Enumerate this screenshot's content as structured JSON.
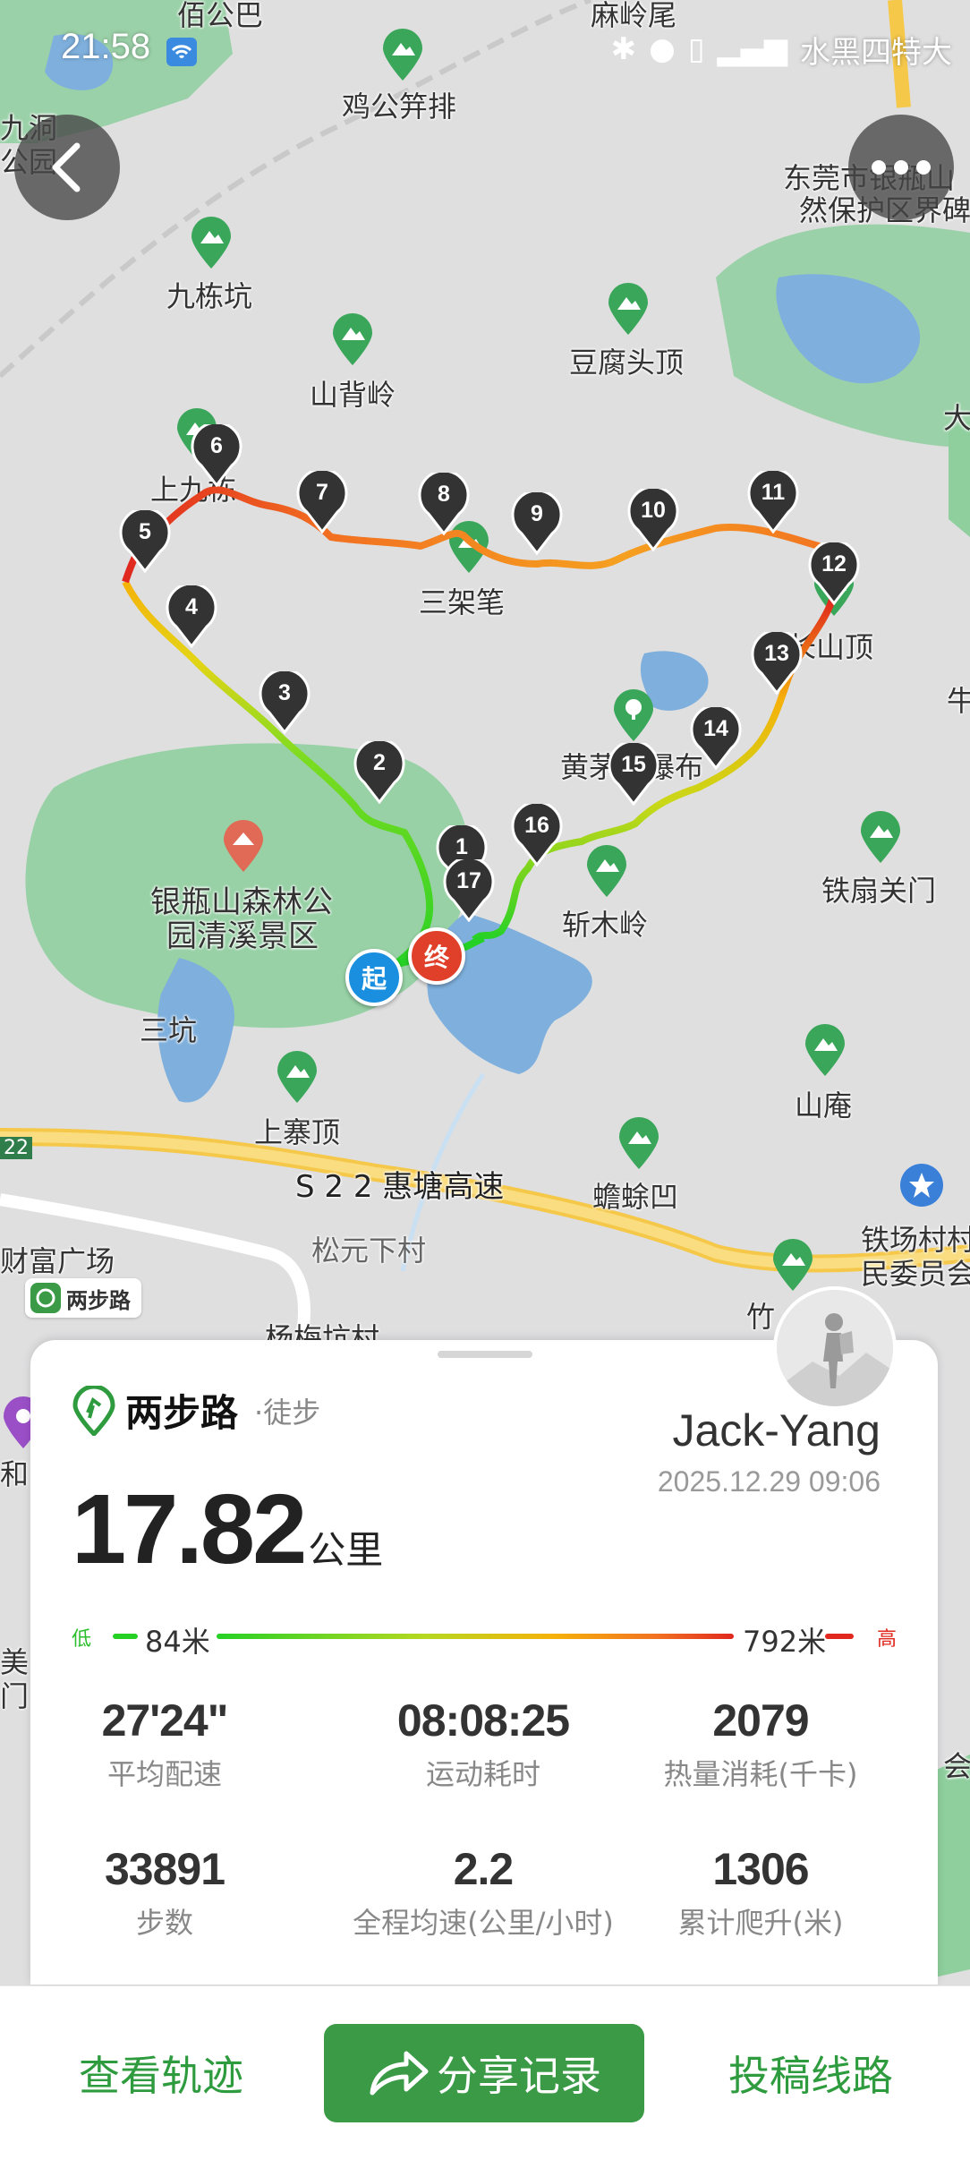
{
  "status_bar": {
    "time": "21:58",
    "carrier_text": "水黑四特大"
  },
  "map": {
    "labels": [
      {
        "text": "佰公巴"
      },
      {
        "text": "麻岭尾"
      },
      {
        "text": "鸡公笄排"
      },
      {
        "text": "九洞"
      },
      {
        "text": "公园"
      },
      {
        "text": "东莞市银瓶山"
      },
      {
        "text": "然保护区界碑"
      },
      {
        "text": "九栋坑"
      },
      {
        "text": "山背岭"
      },
      {
        "text": "豆腐头顶"
      },
      {
        "text": "大"
      },
      {
        "text": "上九栋"
      },
      {
        "text": "三架笔"
      },
      {
        "text": "长山顶"
      },
      {
        "text": "牛"
      },
      {
        "text": "黄茅田瀑布"
      },
      {
        "text": "银瓶山森林公"
      },
      {
        "text": "园清溪景区"
      },
      {
        "text": "斩木岭"
      },
      {
        "text": "铁扇关门"
      },
      {
        "text": "三坑"
      },
      {
        "text": "上寨顶"
      },
      {
        "text": "山庵"
      },
      {
        "text": "S 2 2 惠塘高速"
      },
      {
        "text": "蟾蜍凹"
      },
      {
        "text": "22"
      },
      {
        "text": "财富广场"
      },
      {
        "text": "松元下村"
      },
      {
        "text": "铁场村村"
      },
      {
        "text": "民委员会"
      },
      {
        "text": "杨梅坑村"
      },
      {
        "text": "竹"
      },
      {
        "text": "和"
      },
      {
        "text": "美"
      },
      {
        "text": "门"
      },
      {
        "text": "会"
      }
    ],
    "watermark": "两步路",
    "track_markers": [
      "1",
      "2",
      "3",
      "4",
      "5",
      "6",
      "7",
      "8",
      "9",
      "10",
      "11",
      "12",
      "13",
      "14",
      "15",
      "16",
      "17"
    ],
    "start_label": "起",
    "end_label": "终"
  },
  "card": {
    "brand": "两步路",
    "activity_type": "·徒步",
    "username": "Jack-Yang",
    "datetime": "2025.12.29 09:06",
    "distance_value": "17.82",
    "distance_unit": "公里",
    "elevation": {
      "low_tag": "低",
      "low_value": "84米",
      "high_value": "792米",
      "high_tag": "高"
    },
    "stats": [
      {
        "value": "27'24\"",
        "label": "平均配速"
      },
      {
        "value": "08:08:25",
        "label": "运动耗时"
      },
      {
        "value": "2079",
        "label": "热量消耗(千卡)"
      },
      {
        "value": "33891",
        "label": "步数"
      },
      {
        "value": "2.2",
        "label": "全程均速(公里/小时)"
      },
      {
        "value": "1306",
        "label": "累计爬升(米)"
      }
    ]
  },
  "bottom_bar": {
    "view_track": "查看轨迹",
    "share": "分享记录",
    "submit_route": "投稿线路"
  },
  "colors": {
    "brand_green": "#3a9a46",
    "track_low": "#26d126",
    "track_high": "#e0281e",
    "start_blue": "#1a8fe0",
    "end_red": "#e0402a"
  }
}
